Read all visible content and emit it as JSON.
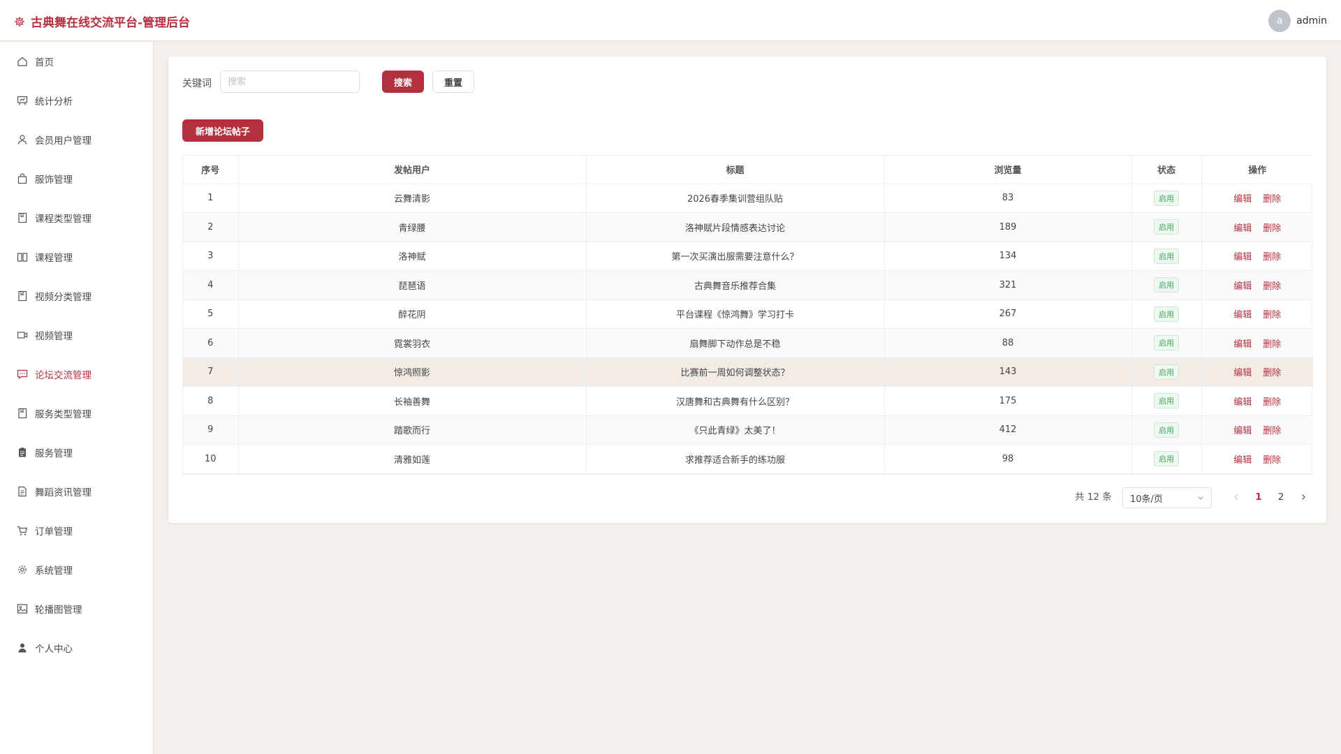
{
  "app": {
    "title": "古典舞在线交流平台-管理后台"
  },
  "user": {
    "avatar_letter": "a",
    "name": "admin"
  },
  "sidebar": {
    "items": [
      {
        "label": "首页",
        "icon": "home-icon"
      },
      {
        "label": "统计分析",
        "icon": "chart-board-icon"
      },
      {
        "label": "会员用户管理",
        "icon": "user-icon"
      },
      {
        "label": "服饰管理",
        "icon": "bag-icon"
      },
      {
        "label": "课程类型管理",
        "icon": "notebook-icon"
      },
      {
        "label": "课程管理",
        "icon": "book-icon"
      },
      {
        "label": "视频分类管理",
        "icon": "notebook-icon"
      },
      {
        "label": "视频管理",
        "icon": "video-icon"
      },
      {
        "label": "论坛交流管理",
        "icon": "chat-icon",
        "active": true
      },
      {
        "label": "服务类型管理",
        "icon": "notebook-icon"
      },
      {
        "label": "服务管理",
        "icon": "clipboard-icon"
      },
      {
        "label": "舞蹈资讯管理",
        "icon": "document-icon"
      },
      {
        "label": "订单管理",
        "icon": "cart-icon"
      },
      {
        "label": "系统管理",
        "icon": "gear-icon"
      },
      {
        "label": "轮播图管理",
        "icon": "picture-icon"
      },
      {
        "label": "个人中心",
        "icon": "person-filled-icon"
      }
    ]
  },
  "search": {
    "label": "关键词",
    "placeholder": "搜索",
    "value": ""
  },
  "buttons": {
    "search": "搜索",
    "reset": "重置",
    "add": "新增论坛帖子"
  },
  "table": {
    "columns": [
      "序号",
      "发帖用户",
      "标题",
      "浏览量",
      "状态",
      "操作"
    ],
    "rows": [
      {
        "no": "1",
        "user": "云舞清影",
        "title": "2026春季集训营组队贴",
        "views": "83",
        "status": "启用"
      },
      {
        "no": "2",
        "user": "青绿腰",
        "title": "洛神赋片段情感表达讨论",
        "views": "189",
        "status": "启用"
      },
      {
        "no": "3",
        "user": "洛神赋",
        "title": "第一次买演出服需要注意什么？",
        "views": "134",
        "status": "启用"
      },
      {
        "no": "4",
        "user": "琵琶语",
        "title": "古典舞音乐推荐合集",
        "views": "321",
        "status": "启用"
      },
      {
        "no": "5",
        "user": "醉花阴",
        "title": "平台课程《惊鸿舞》学习打卡",
        "views": "267",
        "status": "启用"
      },
      {
        "no": "6",
        "user": "霓裳羽衣",
        "title": "扇舞脚下动作总是不稳",
        "views": "88",
        "status": "启用"
      },
      {
        "no": "7",
        "user": "惊鸿照影",
        "title": "比赛前一周如何调整状态？",
        "views": "143",
        "status": "启用"
      },
      {
        "no": "8",
        "user": "长袖善舞",
        "title": "汉唐舞和古典舞有什么区别？",
        "views": "175",
        "status": "启用"
      },
      {
        "no": "9",
        "user": "踏歌而行",
        "title": "《只此青绿》太美了！",
        "views": "412",
        "status": "启用"
      },
      {
        "no": "10",
        "user": "清雅如莲",
        "title": "求推荐适合新手的练功服",
        "views": "98",
        "status": "启用"
      }
    ],
    "actions": {
      "edit": "编辑",
      "delete": "删除"
    }
  },
  "pagination": {
    "total_text": "共 12 条",
    "page_size": "10条/页",
    "pages": [
      "1",
      "2"
    ],
    "current": "1"
  },
  "colors": {
    "accent": "#b5303f",
    "tag_green": "#43a760"
  }
}
